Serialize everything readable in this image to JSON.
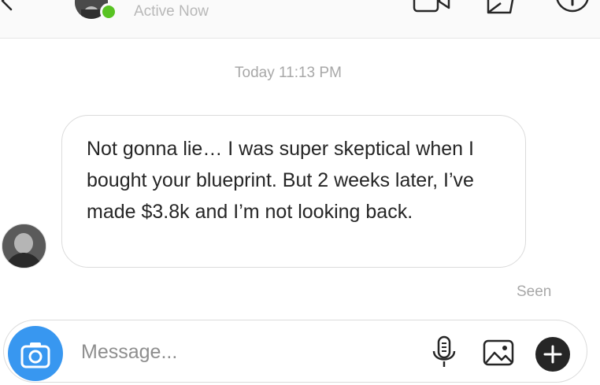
{
  "header": {
    "status_text": "Active Now",
    "icons": [
      "back-chevron-icon",
      "video-call-icon",
      "direct-message-icon",
      "info-icon"
    ]
  },
  "thread": {
    "timestamp": "Today 11:13 PM",
    "messages": [
      {
        "text": "Not gonna lie… I was super skeptical when I bought your blueprint. But 2 weeks later, I’ve made $3.8k and I’m not looking back."
      }
    ],
    "read_receipt": "Seen"
  },
  "composer": {
    "placeholder": "Message...",
    "icons": [
      "camera-icon",
      "microphone-icon",
      "image-icon",
      "plus-icon"
    ]
  },
  "colors": {
    "online": "#58c322",
    "camera_button": "#3897f0",
    "border": "#dbdbdb",
    "muted_text": "#a8a8a8"
  }
}
